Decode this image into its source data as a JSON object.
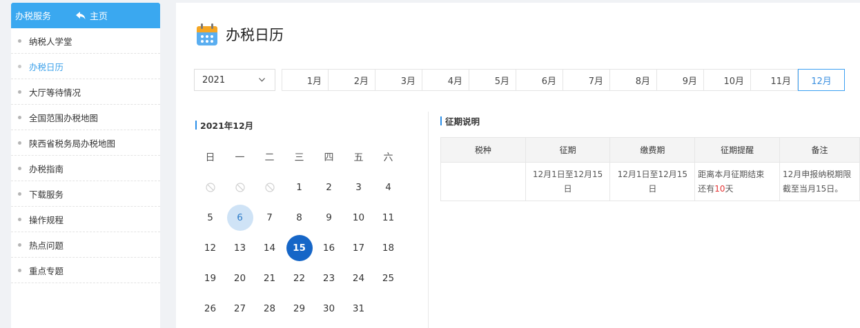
{
  "sidebar": {
    "title": "办税服务",
    "home_label": "主页",
    "items": [
      {
        "label": "纳税人学堂"
      },
      {
        "label": "办税日历"
      },
      {
        "label": "大厅等待情况"
      },
      {
        "label": "全国范围办税地图"
      },
      {
        "label": "陕西省税务局办税地图"
      },
      {
        "label": "办税指南"
      },
      {
        "label": "下载服务"
      },
      {
        "label": "操作规程"
      },
      {
        "label": "热点问题"
      },
      {
        "label": "重点专题"
      }
    ],
    "active_index": 1
  },
  "page": {
    "title": "办税日历",
    "icon": "calendar-icon"
  },
  "filter": {
    "year": "2021",
    "months": [
      "1月",
      "2月",
      "3月",
      "4月",
      "5月",
      "6月",
      "7月",
      "8月",
      "9月",
      "10月",
      "11月",
      "12月"
    ],
    "selected_month": "12月"
  },
  "calendar": {
    "heading": "2021年12月",
    "weekdays": [
      "日",
      "一",
      "二",
      "三",
      "四",
      "五",
      "六"
    ],
    "weeks": [
      [
        "",
        "",
        "",
        "1",
        "2",
        "3",
        "4"
      ],
      [
        "5",
        "6",
        "7",
        "8",
        "9",
        "10",
        "11"
      ],
      [
        "12",
        "13",
        "14",
        "15",
        "16",
        "17",
        "18"
      ],
      [
        "19",
        "20",
        "21",
        "22",
        "23",
        "24",
        "25"
      ],
      [
        "26",
        "27",
        "28",
        "29",
        "30",
        "31",
        ""
      ]
    ],
    "today": "6",
    "deadline": "15"
  },
  "tax_period": {
    "heading": "征期说明",
    "headers": [
      "税种",
      "征期",
      "缴费期",
      "征期提醒",
      "备注"
    ],
    "row": {
      "tax_type": "",
      "period_line1": "12月1日至12月15",
      "period_line2": "日",
      "payment_line1": "12月1日至12月15",
      "payment_line2": "日",
      "reminder_line1": "距离本月征期结束",
      "reminder_prefix": "还有",
      "reminder_days": "10",
      "reminder_suffix": "天",
      "note_line1": "12月申报纳税期限",
      "note_line2": "截至当月15日。"
    }
  },
  "colors": {
    "sidebar_header": "#3aa8f0",
    "accent": "#2a8ee8",
    "deadline": "#1666c7",
    "today": "#cfe3f6",
    "highlight": "#e53434"
  }
}
